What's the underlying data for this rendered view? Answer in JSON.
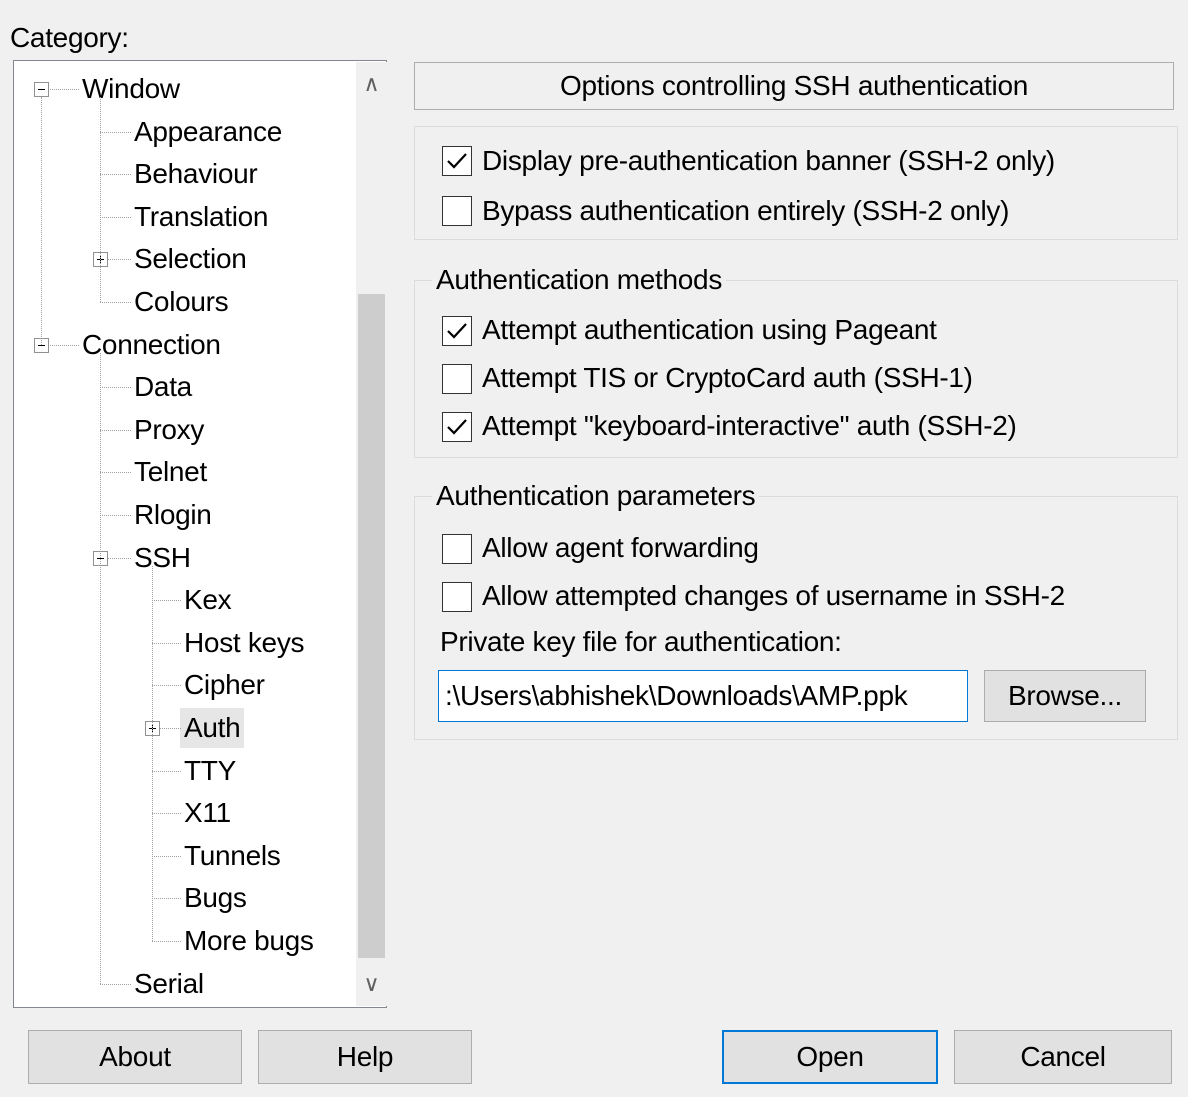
{
  "category_label": "Category:",
  "tree": {
    "items": [
      {
        "label": "Window",
        "level": 0,
        "expander": "minus"
      },
      {
        "label": "Appearance",
        "level": 1
      },
      {
        "label": "Behaviour",
        "level": 1
      },
      {
        "label": "Translation",
        "level": 1
      },
      {
        "label": "Selection",
        "level": 1,
        "expander": "plus"
      },
      {
        "label": "Colours",
        "level": 1
      },
      {
        "label": "Connection",
        "level": 0,
        "expander": "minus"
      },
      {
        "label": "Data",
        "level": 1
      },
      {
        "label": "Proxy",
        "level": 1
      },
      {
        "label": "Telnet",
        "level": 1
      },
      {
        "label": "Rlogin",
        "level": 1
      },
      {
        "label": "SSH",
        "level": 1,
        "expander": "minus"
      },
      {
        "label": "Kex",
        "level": 2
      },
      {
        "label": "Host keys",
        "level": 2
      },
      {
        "label": "Cipher",
        "level": 2
      },
      {
        "label": "Auth",
        "level": 2,
        "expander": "plus",
        "selected": true
      },
      {
        "label": "TTY",
        "level": 2
      },
      {
        "label": "X11",
        "level": 2
      },
      {
        "label": "Tunnels",
        "level": 2
      },
      {
        "label": "Bugs",
        "level": 2
      },
      {
        "label": "More bugs",
        "level": 2
      },
      {
        "label": "Serial",
        "level": 1
      }
    ]
  },
  "panel": {
    "header": "Options controlling SSH authentication",
    "top_options": [
      {
        "label": "Display pre-authentication banner (SSH-2 only)",
        "checked": true
      },
      {
        "label": "Bypass authentication entirely (SSH-2 only)",
        "checked": false
      }
    ],
    "methods": {
      "title": "Authentication methods",
      "options": [
        {
          "label": "Attempt authentication using Pageant",
          "checked": true
        },
        {
          "label": "Attempt TIS or CryptoCard auth (SSH-1)",
          "checked": false
        },
        {
          "label": "Attempt \"keyboard-interactive\" auth (SSH-2)",
          "checked": true
        }
      ]
    },
    "params": {
      "title": "Authentication parameters",
      "options": [
        {
          "label": "Allow agent forwarding",
          "checked": false
        },
        {
          "label": "Allow attempted changes of username in SSH-2",
          "checked": false
        }
      ],
      "keyfile_label": "Private key file for authentication:",
      "keyfile_value": ":\\Users\\abhishek\\Downloads\\AMP.ppk",
      "browse_label": "Browse..."
    }
  },
  "buttons": {
    "about": "About",
    "help": "Help",
    "open": "Open",
    "cancel": "Cancel"
  },
  "colors": {
    "accent": "#0078d7",
    "background": "#f0f0f0"
  }
}
